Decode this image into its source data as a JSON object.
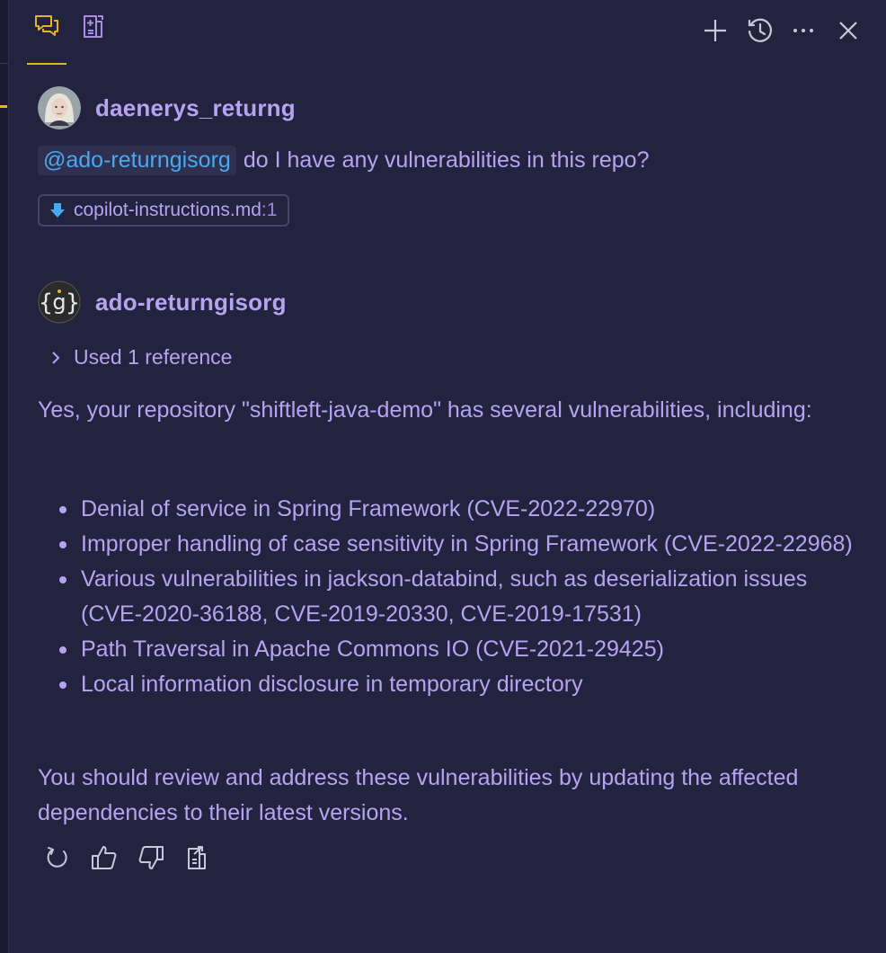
{
  "user_message": {
    "username": "daenerys_returng",
    "mention": "@ado-returngisorg",
    "text": "do I have any vulnerabilities in this repo?",
    "reference_chip": {
      "filename": "copilot-instructions.md",
      "line": ":1"
    }
  },
  "bot_message": {
    "username": "ado-returngisorg",
    "used_references": "Used 1 reference",
    "intro": "Yes, your repository \"shiftleft-java-demo\" has several vulnerabilities, including:",
    "vulnerabilities": [
      "Denial of service in Spring Framework (CVE-2022-22970)",
      "Improper handling of case sensitivity in Spring Framework (CVE-2022-22968)",
      "Various vulnerabilities in jackson-databind, such as deserialization issues (CVE-2020-36188, CVE-2019-20330, CVE-2019-17531)",
      "Path Traversal in Apache Commons IO (CVE-2021-29425)",
      "Local information disclosure in temporary directory"
    ],
    "outro": "You should review and address these vulnerabilities by updating the affected dependencies to their latest versions."
  },
  "icons": {
    "tabs": [
      "chat-icon",
      "notes-icon"
    ],
    "toolbar": [
      "plus-icon",
      "history-icon",
      "more-icon",
      "close-icon"
    ],
    "actions": [
      "retry-icon",
      "thumbs-up-icon",
      "thumbs-down-icon",
      "insert-note-icon"
    ]
  },
  "colors": {
    "background": "#232340",
    "text": "#b7a4f0",
    "mention": "#4aa8f0",
    "accent": "#e6b422",
    "icon": "#c8c8d8"
  }
}
